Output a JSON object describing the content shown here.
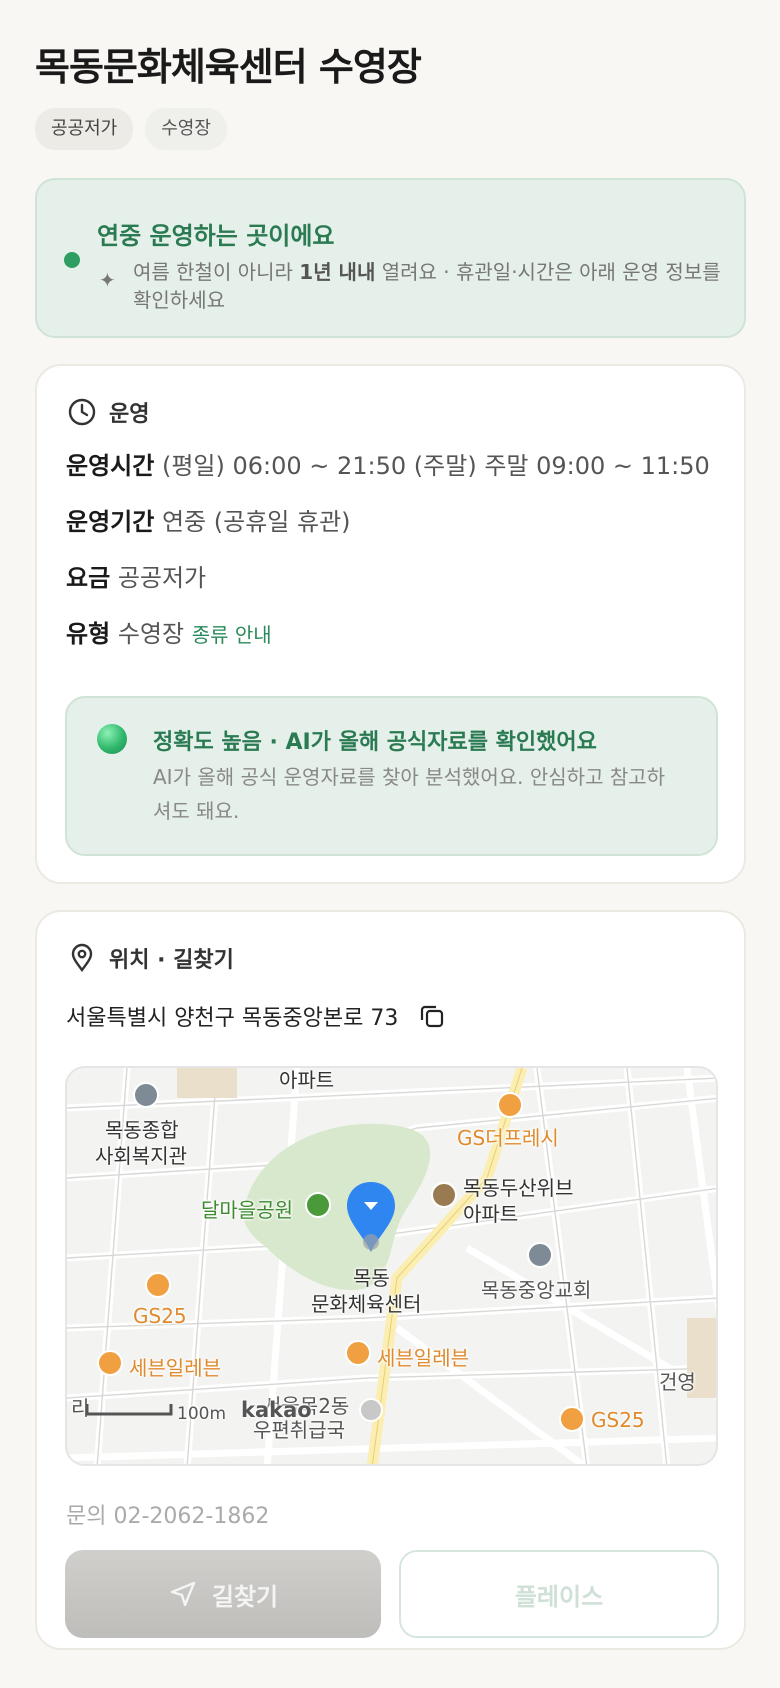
{
  "title": "목동문화체육센터 수영장",
  "chips": [
    "공공저가",
    "수영장"
  ],
  "notice": {
    "title": "연중 운영하는 곳이에요",
    "text_pre": "여름 한철이 아니라 ",
    "text_bold": "1년 내내",
    "text_post": " 열려요 · 휴관일·시간은 아래 운영 정보를 확인하세요"
  },
  "operation": {
    "heading": "운영",
    "hours_label": "운영시간",
    "hours_value": "(평일) 06:00 ~ 21:50 (주말) 주말 09:00 ~ 11:50",
    "period_label": "운영기간",
    "period_value": "연중 (공휴일 휴관)",
    "fee_label": "요금",
    "fee_value": "공공저가",
    "type_label": "유형",
    "type_value": "수영장",
    "type_link": "종류 안내",
    "ai_title": "정확도 높음 · AI가 올해 공식자료를 확인했어요",
    "ai_text": "AI가 올해 공식 운영자료를 찾아 분석했어요. 안심하고 참고하셔도 돼요."
  },
  "location": {
    "heading": "위치 · 길찾기",
    "address": "서울특별시 양천구 목동중앙본로 73",
    "phone": "문의 02-2062-1862",
    "directions_button": "길찾기",
    "place_button": "플레이스"
  },
  "map": {
    "labels": {
      "apt_top": "아파트",
      "gs_fresh": "GS더프레시",
      "welfare1": "목동종합",
      "welfare2": "사회복지관",
      "park": "달마을공원",
      "doosan1": "목동두산위브",
      "doosan2": "아파트",
      "center1": "목동",
      "center2": "문화체육센터",
      "church": "목동중앙교회",
      "gs25_left": "GS25",
      "seven_left": "세븐일레븐",
      "seven_mid": "세븐일레븐",
      "post1": "서울목2동",
      "post2": "우편취급국",
      "gs25_right": "GS25",
      "building_right": "건영",
      "scale": "100m",
      "kakao": "kakao",
      "edge_left": "리"
    }
  },
  "colors": {
    "accent_green": "#2a7a52",
    "pin_blue": "#2f86f0",
    "poi_orange": "#f0a040"
  }
}
